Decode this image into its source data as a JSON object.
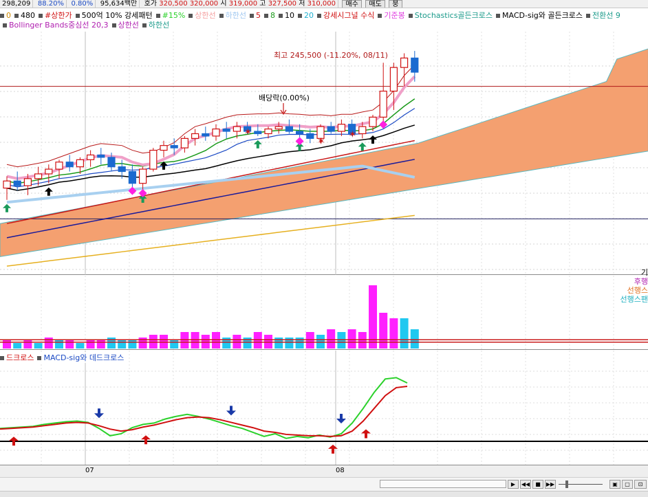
{
  "top_bar": {
    "volume": "298,209",
    "ratio1": "88.20%",
    "ratio2": "0.80%",
    "turnover": "95,634백만",
    "quote_label": "호가",
    "ask": "320,500",
    "bid": "320,000",
    "open_label": "시",
    "open": "319,000",
    "high_label": "고",
    "high": "327,500",
    "low_label": "저",
    "low": "310,000",
    "buy_button": "매수",
    "sell_button": "매도",
    "extra_button": "붕"
  },
  "legend_row1": [
    {
      "label": "0",
      "color": "#d08a00"
    },
    {
      "label": "480",
      "color": "#000000"
    },
    {
      "label": "#상한가",
      "color": "#d01010"
    },
    {
      "label": "500억 10% 강세패턴",
      "color": "#000000"
    },
    {
      "label": "#15%",
      "color": "#2bd12b"
    },
    {
      "label": "상한선",
      "color": "#f5a0a0"
    },
    {
      "label": "하한선",
      "color": "#a0c8f0"
    },
    {
      "label": "5",
      "color": "#d01010"
    },
    {
      "label": "8",
      "color": "#1a9a1a"
    },
    {
      "label": "10",
      "color": "#000000"
    },
    {
      "label": "20",
      "color": "#20b0d0"
    },
    {
      "label": "강세시그널 수식",
      "color": "#d01010"
    },
    {
      "label": "기준봉",
      "color": "#e040e0"
    },
    {
      "label": "Stochastics골든크로스",
      "color": "#1a9a8a"
    },
    {
      "label": "MACD-sig와 골든크로스",
      "color": "#000000"
    },
    {
      "label": "전환선 9",
      "color": "#1a9a8a"
    }
  ],
  "legend_row2": [
    {
      "label": "Bollinger Bands중심선 20,3",
      "color": "#b020b0"
    },
    {
      "label": "상한선",
      "color": "#b020b0"
    },
    {
      "label": "하한선",
      "color": "#1a9a8a"
    }
  ],
  "annotations": {
    "high_label": "최고 245,500 (-11.20%, 08/11)",
    "dividend_label": "배당락(0.00%)"
  },
  "side_labels": [
    {
      "label": "기",
      "color": "#000000"
    },
    {
      "label": "후행",
      "color": "#b020b0"
    },
    {
      "label": "선행스",
      "color": "#e07020"
    },
    {
      "label": "선행스팬",
      "color": "#20b0c0"
    }
  ],
  "macd_legend": [
    {
      "label": "드크로스",
      "color": "#d01010"
    },
    {
      "label": "MACD-sig와 데드크로스",
      "color": "#1a49c4"
    }
  ],
  "x_axis": [
    {
      "label": "07"
    },
    {
      "label": "08"
    }
  ],
  "colors": {
    "up_candle": "#d01010",
    "down_candle": "#1a6ad0",
    "volume_up": "#ff20ff",
    "volume_down": "#20c8f0",
    "cloud": "#f4a070",
    "macd": "#2bd12b",
    "signal": "#d01010"
  },
  "chart_data": {
    "type": "candlestick",
    "note_candles": "open, high, low, close per session (relative price units)",
    "candles": [
      [
        205,
        210,
        200,
        208
      ],
      [
        208,
        212,
        204,
        206
      ],
      [
        206,
        211,
        202,
        209
      ],
      [
        209,
        214,
        206,
        211
      ],
      [
        211,
        215,
        207,
        213
      ],
      [
        213,
        217,
        209,
        216
      ],
      [
        216,
        219,
        212,
        214
      ],
      [
        214,
        218,
        211,
        217
      ],
      [
        217,
        221,
        214,
        219
      ],
      [
        219,
        222,
        215,
        218
      ],
      [
        218,
        220,
        212,
        214
      ],
      [
        214,
        217,
        209,
        212
      ],
      [
        212,
        215,
        205,
        207
      ],
      [
        207,
        214,
        204,
        213
      ],
      [
        213,
        222,
        212,
        221
      ],
      [
        221,
        225,
        218,
        223
      ],
      [
        223,
        226,
        219,
        222
      ],
      [
        222,
        227,
        220,
        226
      ],
      [
        226,
        230,
        223,
        228
      ],
      [
        228,
        231,
        225,
        227
      ],
      [
        227,
        232,
        225,
        230
      ],
      [
        230,
        233,
        226,
        229
      ],
      [
        229,
        233,
        226,
        231
      ],
      [
        231,
        233,
        228,
        229
      ],
      [
        229,
        232,
        227,
        228
      ],
      [
        228,
        231,
        226,
        230
      ],
      [
        230,
        233,
        228,
        231
      ],
      [
        231,
        234,
        228,
        229
      ],
      [
        229,
        232,
        226,
        228
      ],
      [
        228,
        230,
        224,
        226
      ],
      [
        226,
        232,
        224,
        231
      ],
      [
        231,
        233,
        228,
        229
      ],
      [
        229,
        234,
        227,
        232
      ],
      [
        232,
        234,
        227,
        228
      ],
      [
        228,
        233,
        226,
        231
      ],
      [
        231,
        236,
        229,
        235
      ],
      [
        235,
        258,
        233,
        246
      ],
      [
        246,
        258,
        238,
        256
      ],
      [
        256,
        262,
        248,
        260
      ],
      [
        260,
        263,
        250,
        254
      ]
    ],
    "volume": [
      3,
      2,
      3,
      2,
      4,
      3,
      3,
      2,
      3,
      3,
      4,
      3,
      3,
      4,
      5,
      5,
      3,
      6,
      6,
      5,
      6,
      4,
      5,
      4,
      6,
      5,
      4,
      4,
      4,
      6,
      5,
      7,
      6,
      7,
      6,
      23,
      13,
      11,
      11,
      7
    ],
    "volume_up": [
      true,
      false,
      true,
      false,
      true,
      false,
      true,
      false,
      true,
      true,
      false,
      false,
      false,
      true,
      true,
      true,
      false,
      true,
      true,
      true,
      true,
      false,
      true,
      false,
      true,
      true,
      false,
      false,
      false,
      true,
      false,
      true,
      false,
      true,
      true,
      true,
      true,
      true,
      false,
      false
    ],
    "macd": [
      0.2,
      0.3,
      0.4,
      0.5,
      0.8,
      1.0,
      1.2,
      1.3,
      1.1,
      0.2,
      -0.9,
      -0.6,
      0.3,
      0.8,
      1.0,
      1.6,
      2.0,
      2.3,
      2.0,
      1.6,
      1.1,
      0.6,
      0.2,
      -0.4,
      -1.0,
      -0.6,
      -1.3,
      -1.0,
      -1.2,
      -0.8,
      -1.1,
      -0.6,
      1.0,
      3.2,
      5.6,
      7.6,
      7.8,
      7.0
    ],
    "signal": [
      0.1,
      0.2,
      0.3,
      0.4,
      0.6,
      0.8,
      1.0,
      1.1,
      1.0,
      0.6,
      0.1,
      -0.2,
      0.0,
      0.4,
      0.7,
      1.1,
      1.5,
      1.8,
      1.9,
      1.8,
      1.5,
      1.1,
      0.7,
      0.3,
      -0.2,
      -0.4,
      -0.7,
      -0.8,
      -0.9,
      -0.9,
      -1.0,
      -0.9,
      -0.2,
      1.3,
      3.2,
      5.1,
      6.3,
      6.5
    ],
    "ylim_price": [
      170,
      270
    ],
    "ylim_volume": [
      0,
      25
    ],
    "ylim_macd": [
      -4,
      10
    ]
  }
}
